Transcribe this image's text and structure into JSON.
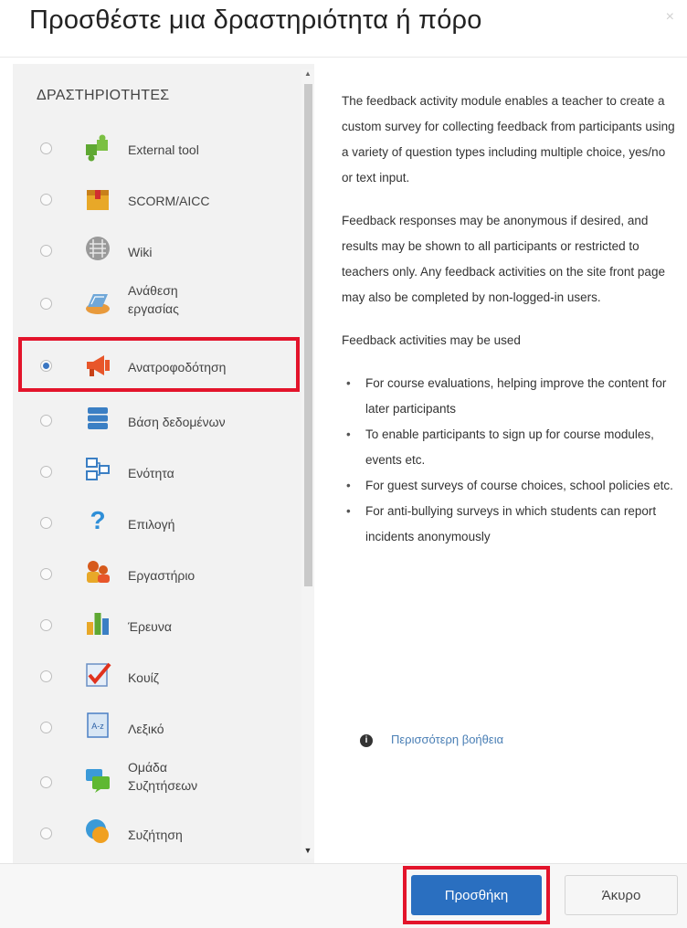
{
  "dialog": {
    "title": "Προσθέστε μια δραστηριότητα ή πόρο",
    "close": "×"
  },
  "list": {
    "category": "ΔΡΑΣΤΗΡΙΟΤΗΤΕΣ",
    "items": [
      {
        "label": "External tool",
        "icon": "puzzle-icon"
      },
      {
        "label": "SCORM/AICC",
        "icon": "scorm-package-icon"
      },
      {
        "label": "Wiki",
        "icon": "wiki-icon"
      },
      {
        "label": "Ανάθεση\nεργασίας",
        "icon": "assignment-icon"
      },
      {
        "label": "Ανατροφοδότηση",
        "icon": "megaphone-icon",
        "selected": true
      },
      {
        "label": "Βάση δεδομένων",
        "icon": "database-icon"
      },
      {
        "label": "Ενότητα",
        "icon": "lesson-icon"
      },
      {
        "label": "Επιλογή",
        "icon": "question-icon"
      },
      {
        "label": "Εργαστήριο",
        "icon": "workshop-icon"
      },
      {
        "label": "Έρευνα",
        "icon": "bar-chart-icon"
      },
      {
        "label": "Κουίζ",
        "icon": "quiz-check-icon"
      },
      {
        "label": "Λεξικό",
        "icon": "glossary-icon"
      },
      {
        "label": "Ομάδα\nΣυζητήσεων",
        "icon": "chat-group-icon"
      },
      {
        "label": "Συζήτηση",
        "icon": "chat-bubble-icon"
      }
    ]
  },
  "description": {
    "p1": "The feedback activity module enables a teacher to create a custom survey for collecting feedback from participants using a variety of question types including multiple choice, yes/no or text input.",
    "p2": "Feedback responses may be anonymous if desired, and results may be shown to all participants or restricted to teachers only. Any feedback activities on the site front page may also be completed by non-logged-in users.",
    "p3": "Feedback activities may be used",
    "bullets": [
      "For course evaluations, helping improve the content for later participants",
      "To enable participants to sign up for course modules, events etc.",
      "For guest surveys of course choices, school policies etc.",
      "For anti-bullying surveys in which students can report incidents anonymously"
    ],
    "help_link": "Περισσότερη βοήθεια"
  },
  "footer": {
    "add": "Προσθήκη",
    "cancel": "Άκυρο"
  }
}
